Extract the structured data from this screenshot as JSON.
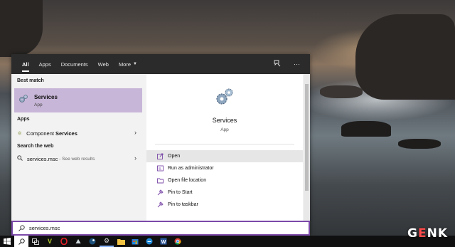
{
  "search_tabs": [
    {
      "label": "All",
      "active": true
    },
    {
      "label": "Apps"
    },
    {
      "label": "Documents"
    },
    {
      "label": "Web"
    },
    {
      "label": "More"
    }
  ],
  "top_icons": [
    "feedback-icon",
    "more-options-icon"
  ],
  "left": {
    "best_match_header": "Best match",
    "best_match": {
      "name": "Services",
      "type": "App",
      "icon": "gears-icon"
    },
    "apps_header": "Apps",
    "apps": [
      {
        "prefix": "Component ",
        "highlight": "Services",
        "icon": "component-services-icon"
      }
    ],
    "web_header": "Search the web",
    "web": {
      "query": "services.msc",
      "suffix": " - See web results"
    }
  },
  "right": {
    "title": "Services",
    "subtitle": "App",
    "actions": [
      {
        "label": "Open",
        "icon": "open-icon"
      },
      {
        "label": "Run as administrator",
        "icon": "shield-icon"
      },
      {
        "label": "Open file location",
        "icon": "folder-icon"
      },
      {
        "label": "Pin to Start",
        "icon": "pin-icon"
      },
      {
        "label": "Pin to taskbar",
        "icon": "pin-icon"
      }
    ]
  },
  "search": {
    "value": "services.msc"
  },
  "taskbar": {
    "items": [
      "windows-start-icon",
      "search-icon",
      "task-view-icon",
      "app-v-icon",
      "opera-icon",
      "photos-icon",
      "steam-icon",
      "settings-icon",
      "file-explorer-icon",
      "store-icon",
      "edge-icon",
      "word-icon",
      "chrome-icon"
    ]
  },
  "watermark": {
    "text_pre": "G",
    "text_e": "E",
    "text_post": "NK"
  },
  "colors": {
    "accent": "#7b4aa8",
    "best_match_bg": "#c8b6d8",
    "topbar": "#2b2b2b"
  }
}
